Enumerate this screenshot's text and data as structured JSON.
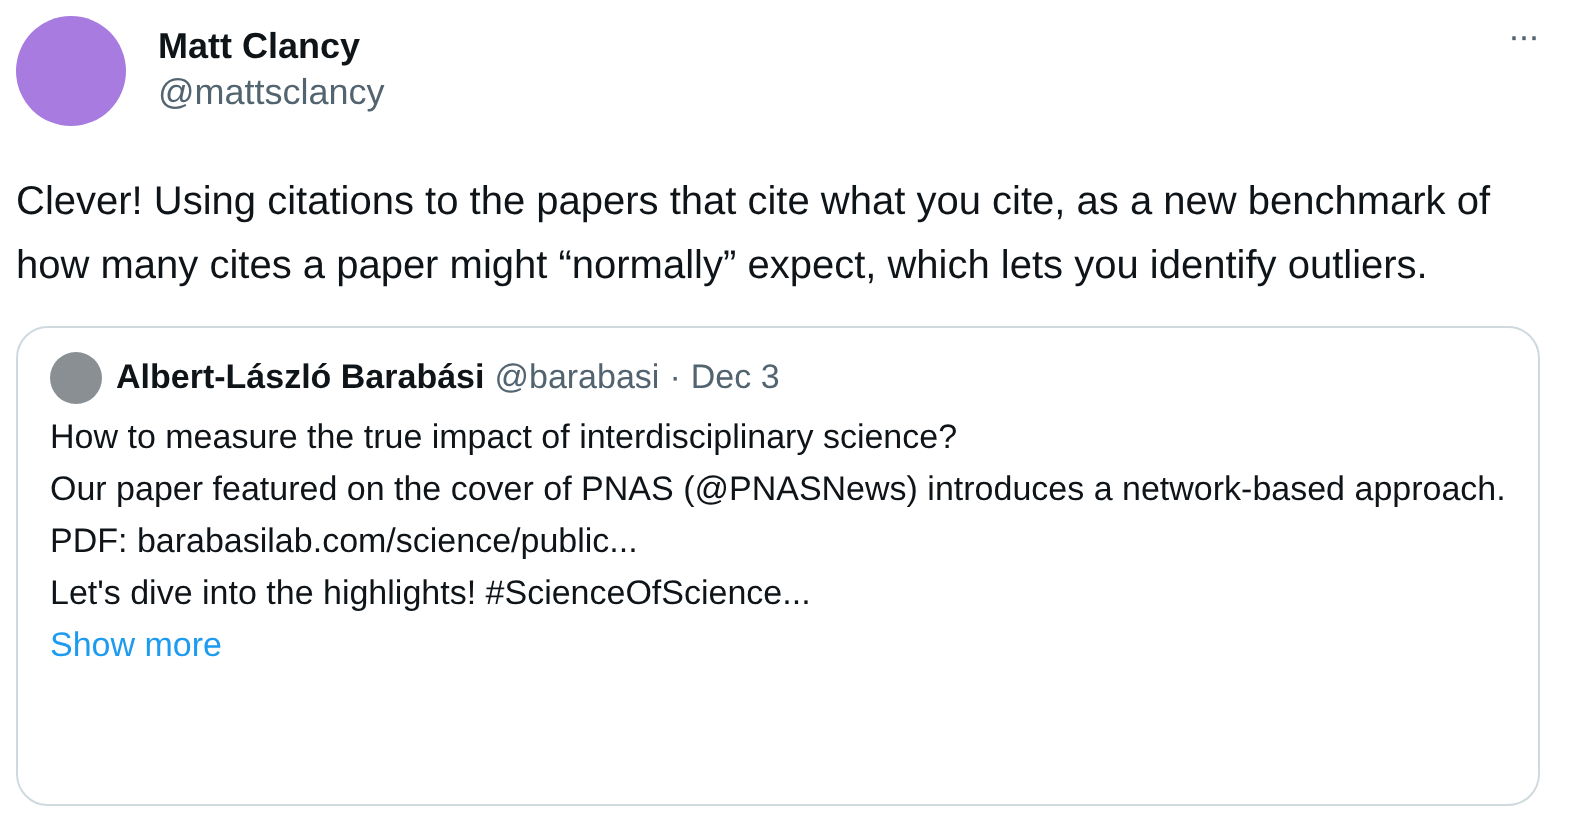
{
  "author": {
    "name": "Matt Clancy",
    "handle": "@mattsclancy"
  },
  "more_menu": {
    "label": "···"
  },
  "text": "Clever! Using citations to the papers that cite what you cite, as a new benchmark of how many cites a paper might “normally” expect, which lets you identify outliers.",
  "quoted_post": {
    "author": {
      "name": "Albert-László Barabási",
      "handle": "@barabasi",
      "separator": "·",
      "date": "Dec 3"
    },
    "lines": [
      "How to measure the true impact of interdisciplinary science?",
      "Our paper featured on the cover of PNAS (@PNASNews) introduces a network-based approach.",
      "PDF: barabasilab.com/science/public...",
      "Let's dive into the highlights! #ScienceOfScience..."
    ],
    "show_more": "Show more"
  }
}
